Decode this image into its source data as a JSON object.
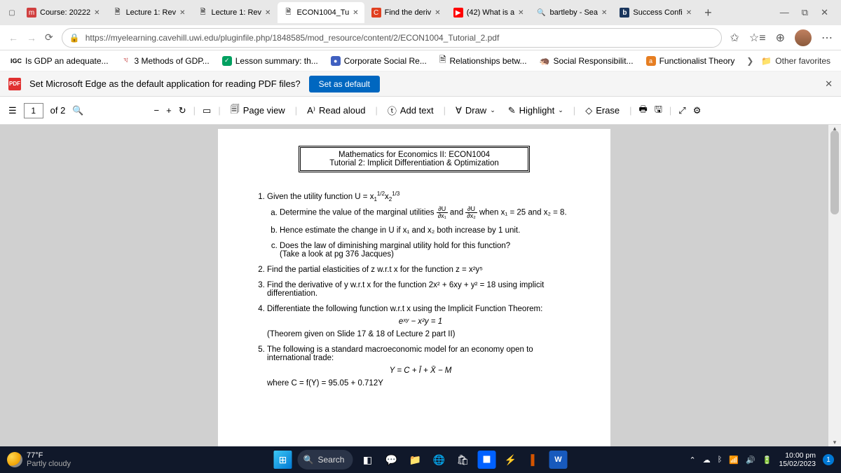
{
  "tabs": [
    {
      "icon": "m",
      "iconbg": "#d04040",
      "label": "Course: 20222"
    },
    {
      "icon": "📄",
      "iconbg": "",
      "label": "Lecture 1: Rev"
    },
    {
      "icon": "📄",
      "iconbg": "",
      "label": "Lecture 1: Rev"
    },
    {
      "icon": "📄",
      "iconbg": "",
      "label": "ECON1004_Tu",
      "active": true
    },
    {
      "icon": "C",
      "iconbg": "#e04020",
      "label": "Find the deriv"
    },
    {
      "icon": "▶",
      "iconbg": "#ff0000",
      "label": "(42) What is a"
    },
    {
      "icon": "🔍",
      "iconbg": "",
      "label": "bartleby - Sea"
    },
    {
      "icon": "b",
      "iconbg": "#1a365d",
      "label": "Success Confi"
    }
  ],
  "url": "https://myelearning.cavehill.uwi.edu/pluginfile.php/1848585/mod_resource/content/2/ECON1004_Tutorial_2.pdf",
  "bookmarks": [
    {
      "icon": "IGC",
      "bg": "",
      "label": "Is GDP an adequate..."
    },
    {
      "icon": "ঘ",
      "bg": "",
      "label": "3 Methods of GDP..."
    },
    {
      "icon": "✓",
      "bg": "#00a060",
      "label": "Lesson summary: th..."
    },
    {
      "icon": "●",
      "bg": "#4060c0",
      "label": "Corporate Social Re..."
    },
    {
      "icon": "📄",
      "bg": "",
      "label": "Relationships betw..."
    },
    {
      "icon": "🦔",
      "bg": "",
      "label": "Social Responsibilit..."
    },
    {
      "icon": "a",
      "bg": "#e67e22",
      "label": "Functionalist Theory"
    }
  ],
  "other_fav": "Other favorites",
  "banner": {
    "text": "Set Microsoft Edge as the default application for reading PDF files?",
    "button": "Set as default"
  },
  "pdftb": {
    "page": "1",
    "of": "of 2",
    "pageview": "Page view",
    "readaloud": "Read aloud",
    "addtext": "Add text",
    "draw": "Draw",
    "highlight": "Highlight",
    "erase": "Erase"
  },
  "doc": {
    "t1": "Mathematics for Economics II: ECON1004",
    "t2": "Tutorial 2: Implicit Differentiation & Optimization",
    "q1": "Given the utility function U = x",
    "q1e1": "1/2",
    "q1e2": "1/3",
    "q1a": "Determine the value of the marginal utilities ",
    "q1a2": " and ",
    "q1a3": " when x₁ = 25 and x₂ = 8.",
    "q1b": "Hence estimate the change in U if x₁ and x₂ both increase by 1 unit.",
    "q1c": "Does the law of diminishing marginal utility hold for this function?",
    "q1c2": "(Take a look at pg 376 Jacques)",
    "q2": "Find the partial elasticities of z w.r.t x for the function z = x²y⁵",
    "q3": "Find the derivative of y w.r.t x for the function 2x² + 6xy + y² = 18 using implicit differentiation.",
    "q4": "Differentiate the following function w.r.t x using the Implicit Function Theorem:",
    "q4e": "eˣʸ − x²y = 1",
    "q4n": "(Theorem given on Slide 17 & 18 of Lecture 2 part II)",
    "q5": "The following is a standard macroeconomic model for an economy open to international trade:",
    "q5e": "Y = C + Ī + X̄ − M",
    "q5n": "where C = f(Y) = 95.05 + 0.712Y"
  },
  "taskbar": {
    "temp": "77°F",
    "cond": "Partly cloudy",
    "search": "Search",
    "time": "10:00 pm",
    "date": "15/02/2023",
    "notif": "1"
  }
}
